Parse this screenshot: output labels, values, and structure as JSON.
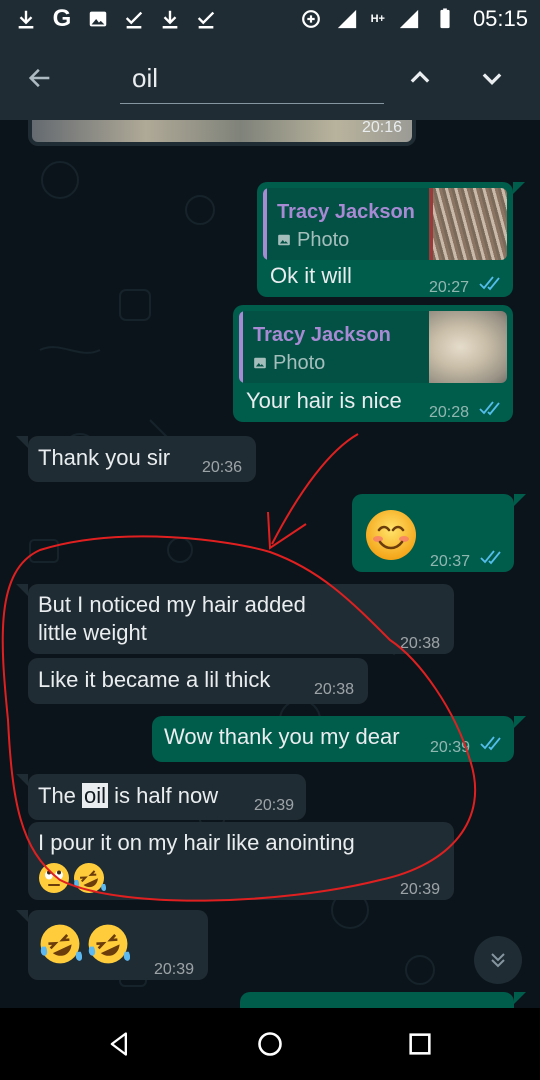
{
  "status_bar": {
    "time": "05:15",
    "network_label": "H+",
    "left_icons": [
      "download-icon",
      "google-icon",
      "gallery-icon",
      "check-download-icon",
      "download-icon",
      "check-download-icon"
    ],
    "google_letter": "G"
  },
  "search": {
    "query": "oil"
  },
  "colors": {
    "incoming": "#202c33",
    "outgoing": "#005c4b",
    "quote_name": "#a88ad4",
    "ticks": "#53bdeb",
    "annotation": "#e02020"
  },
  "messages": [
    {
      "id": "m0",
      "direction": "in",
      "type": "image",
      "time": "20:16"
    },
    {
      "id": "m1",
      "direction": "out",
      "reply_to": {
        "name": "Tracy Jackson",
        "type": "Photo"
      },
      "text": "Ok it will",
      "time": "20:27",
      "status": "read"
    },
    {
      "id": "m2",
      "direction": "out",
      "reply_to": {
        "name": "Tracy Jackson",
        "type": "Photo"
      },
      "text": "Your hair is nice",
      "time": "20:28",
      "status": "read"
    },
    {
      "id": "m3",
      "direction": "in",
      "text": "Thank you sir",
      "time": "20:36"
    },
    {
      "id": "m4",
      "direction": "out",
      "emoji": "smiling-face-icon",
      "time": "20:37",
      "status": "read"
    },
    {
      "id": "m5",
      "direction": "in",
      "lines": [
        "But I noticed my hair added",
        "little weight"
      ],
      "time": "20:38"
    },
    {
      "id": "m6",
      "direction": "in",
      "text": "Like it became a lil thick",
      "time": "20:38"
    },
    {
      "id": "m7",
      "direction": "out",
      "text": "Wow thank you my dear",
      "time": "20:39",
      "status": "read"
    },
    {
      "id": "m8",
      "direction": "in",
      "text_before": "The ",
      "highlight": "oil",
      "text_after": " is half now",
      "time": "20:39"
    },
    {
      "id": "m9",
      "direction": "in",
      "text": "I pour it on my hair like anointing",
      "emojis": [
        "eye-roll-emoji-icon",
        "rolling-laughing-emoji-icon"
      ],
      "time": "20:39"
    },
    {
      "id": "m10",
      "direction": "in",
      "emojis": [
        "rolling-laughing-emoji-icon",
        "rolling-laughing-emoji-icon"
      ],
      "time": "20:39"
    },
    {
      "id": "m11",
      "direction": "out",
      "text": "",
      "partial": true
    }
  ]
}
